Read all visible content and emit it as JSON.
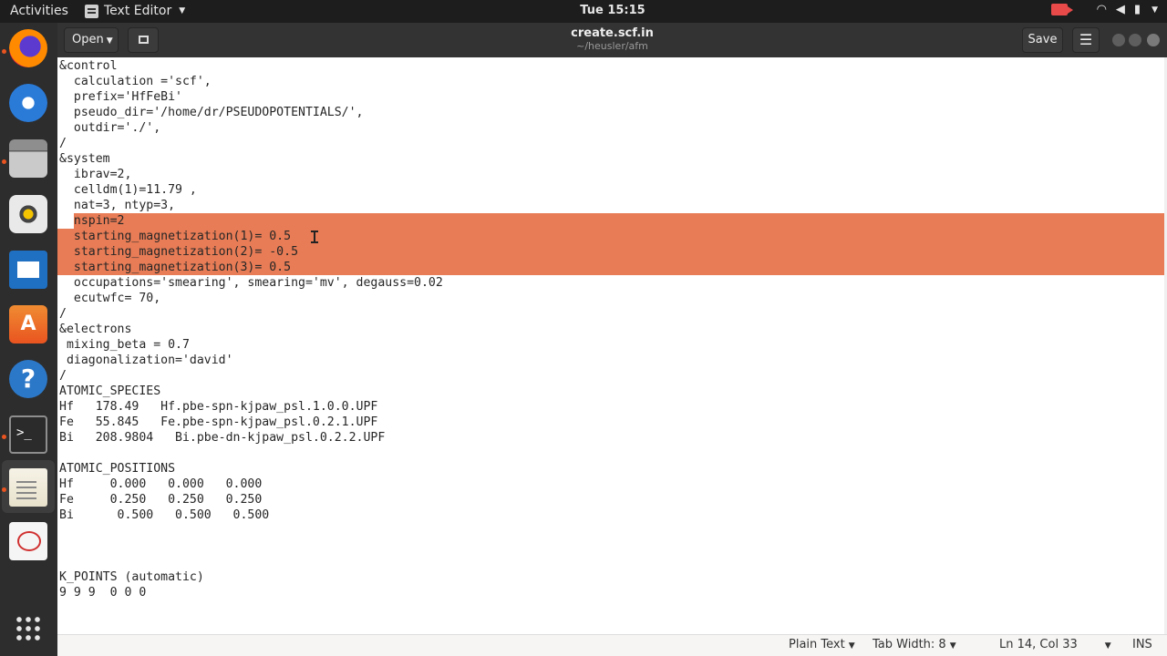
{
  "topbar": {
    "activities": "Activities",
    "app_name": "Text Editor",
    "clock": "Tue 15:15"
  },
  "headerbar": {
    "open_label": "Open",
    "title": "create.scf.in",
    "subtitle": "~/heusler/afm",
    "save_label": "Save"
  },
  "editor": {
    "lines": [
      "&control",
      "  calculation ='scf',",
      "  prefix='HfFeBi'",
      "  pseudo_dir='/home/dr/PSEUDOPOTENTIALS/',",
      "  outdir='./',",
      "/",
      "&system",
      "  ibrav=2,",
      "  celldm(1)=11.79 ,",
      "  nat=3, ntyp=3,",
      "  nspin=2",
      "  starting_magnetization(1)= 0.5",
      "  starting_magnetization(2)= -0.5",
      "  starting_magnetization(3)= 0.5",
      "  occupations='smearing', smearing='mv', degauss=0.02",
      "  ecutwfc= 70,",
      "/",
      "&electrons",
      " mixing_beta = 0.7",
      " diagonalization='david'",
      "/",
      "ATOMIC_SPECIES",
      "Hf   178.49   Hf.pbe-spn-kjpaw_psl.1.0.0.UPF",
      "Fe   55.845   Fe.pbe-spn-kjpaw_psl.0.2.1.UPF",
      "Bi   208.9804   Bi.pbe-dn-kjpaw_psl.0.2.2.UPF",
      "",
      "ATOMIC_POSITIONS",
      "Hf     0.000   0.000   0.000",
      "Fe     0.250   0.250   0.250",
      "Bi      0.500   0.500   0.500",
      "",
      "",
      "",
      "K_POINTS (automatic)",
      "9 9 9  0 0 0"
    ],
    "selection_lines": [
      11,
      12,
      13,
      14
    ]
  },
  "statusbar": {
    "syntax": "Plain Text",
    "tab_width": "Tab Width: 8",
    "position": "Ln 14, Col 33",
    "mode": "INS"
  },
  "dock": {
    "items": [
      "firefox-icon",
      "thunderbird-icon",
      "files-icon",
      "rhythmbox-icon",
      "libreoffice-writer-icon",
      "software-center-icon",
      "help-icon",
      "terminal-icon",
      "text-editor-icon",
      "document-viewer-icon",
      "show-applications-icon"
    ]
  }
}
